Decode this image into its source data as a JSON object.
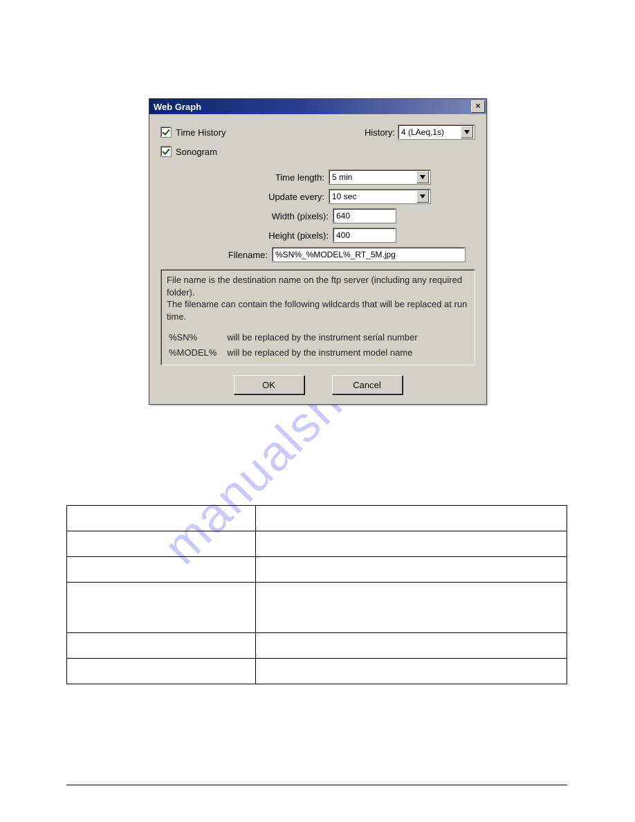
{
  "dialog": {
    "title": "Web Graph",
    "checkboxes": {
      "time_history": {
        "label": "Time History",
        "checked": true
      },
      "sonogram": {
        "label": "Sonogram",
        "checked": true
      }
    },
    "history": {
      "label": "History:",
      "value": "4 (LAeq,1s)"
    },
    "fields": {
      "time_length": {
        "label": "Time length:",
        "value": "5 min",
        "type": "select"
      },
      "update_every": {
        "label": "Update every:",
        "value": "10 sec",
        "type": "select"
      },
      "width": {
        "label": "Width (pixels):",
        "value": "640",
        "type": "text"
      },
      "height": {
        "label": "Height (pixels):",
        "value": "400",
        "type": "text"
      },
      "filename": {
        "label": "Filename:",
        "value": "%SN%_%MODEL%_RT_5M.jpg",
        "type": "text"
      }
    },
    "help": {
      "intro1": "File name is the destination name on the ftp server (including any required folder).",
      "intro2": "The filename can contain the following wildcards that will be replaced at run time.",
      "wildcards": [
        {
          "token": "%SN%",
          "desc": "will be replaced by the instrument serial number"
        },
        {
          "token": "%MODEL%",
          "desc": "will be replaced by the instrument model name"
        }
      ]
    },
    "buttons": {
      "ok": "OK",
      "cancel": "Cancel"
    }
  },
  "watermark": "manualshive.com",
  "doc_table_rows": [
    {
      "tall": false
    },
    {
      "tall": false
    },
    {
      "tall": false
    },
    {
      "tall": true
    },
    {
      "tall": false
    },
    {
      "tall": false
    }
  ]
}
